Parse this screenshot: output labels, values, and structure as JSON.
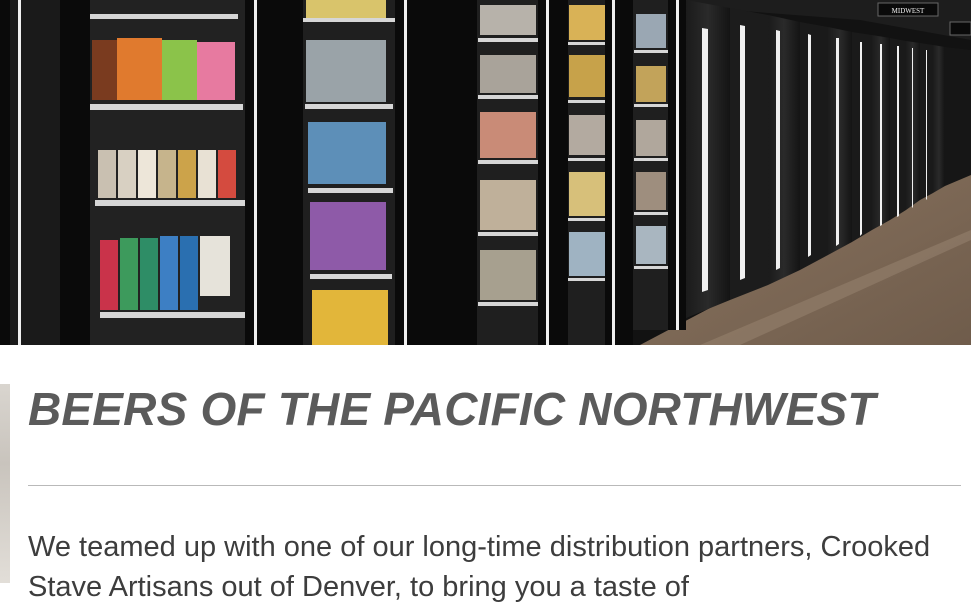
{
  "hero": {
    "photo_icon": "beer-cooler-photo",
    "sign_text": "MIDWEST"
  },
  "article": {
    "title": "BEERS OF THE PACIFIC NORTHWEST",
    "body": "We teamed up with one of our long-time distribution partners, Crooked Stave Artisans out of Denver, to bring you a taste of"
  },
  "colors": {
    "title": "#5b5b5b",
    "body": "#3d3d3d",
    "divider": "#b9b9b9",
    "accent_light": "#f0f0f0"
  }
}
